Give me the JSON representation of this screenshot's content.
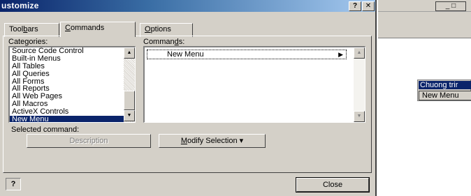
{
  "dialog": {
    "title": "ustomize",
    "help_glyph": "?",
    "close_glyph": "✕",
    "tabs": [
      {
        "pre": "Tool",
        "key": "b",
        "post": "ars"
      },
      {
        "pre": "",
        "key": "C",
        "post": "ommands"
      },
      {
        "pre": "",
        "key": "O",
        "post": "ptions"
      }
    ],
    "active_tab": "Commands",
    "categories_label": {
      "pre": "Cate",
      "key": "g",
      "post": "ories:"
    },
    "commands_label": {
      "pre": "Comman",
      "key": "d",
      "post": "s:"
    },
    "categories": [
      "Source Code Control",
      "Built-in Menus",
      "All Tables",
      "All Queries",
      "All Forms",
      "All Reports",
      "All Web Pages",
      "All Macros",
      "ActiveX Controls",
      "New Menu"
    ],
    "selected_category": "New Menu",
    "command_item": "New Menu",
    "submenu_arrow": "▶",
    "selected_command_label": "Selected command:",
    "description_button": "Description",
    "modify_selection_button": {
      "pre": "",
      "key": "M",
      "post": "odify Selection ▾"
    },
    "help_icon_glyph": "?",
    "close_button": "Close"
  },
  "background_window": {
    "control_glyphs": "_ □",
    "toolbar_title": "Chuong trir",
    "toolbar_menu": "New Menu"
  },
  "colors": {
    "dialog_face": "#d4d0c8",
    "title_active": "#0a246a",
    "selection": "#0a246a"
  }
}
